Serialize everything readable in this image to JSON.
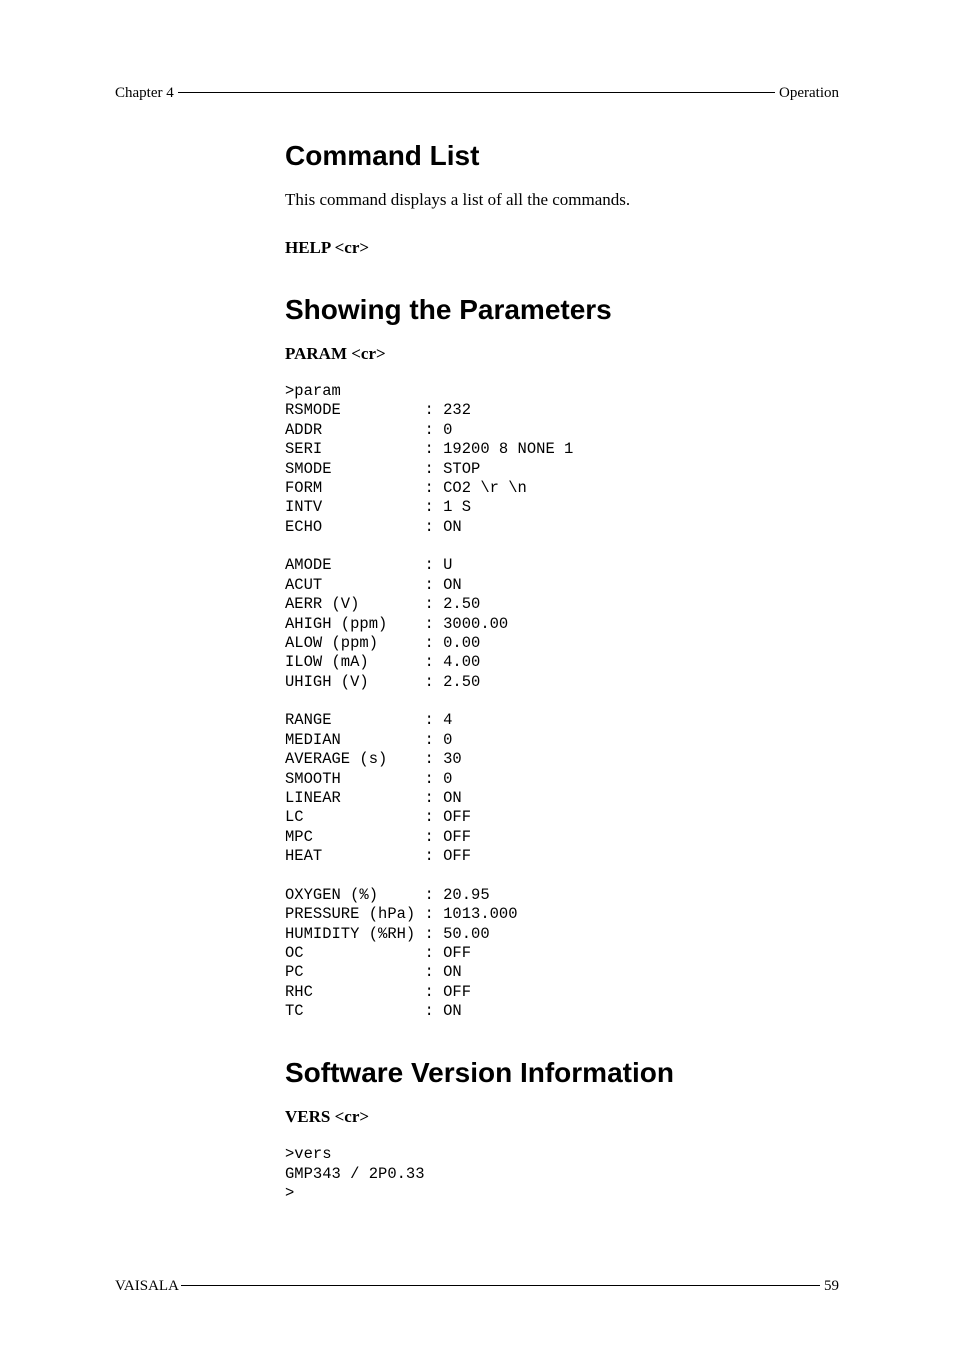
{
  "header": {
    "left": "Chapter 4",
    "right": "Operation"
  },
  "sections": {
    "command_list": {
      "title": "Command List",
      "desc": "This command displays a list of all the commands.",
      "cmd": "HELP <cr>"
    },
    "showing_params": {
      "title": "Showing the Parameters",
      "cmd": "PARAM <cr>",
      "output": ">param\nRSMODE         : 232\nADDR           : 0\nSERI           : 19200 8 NONE 1\nSMODE          : STOP\nFORM           : CO2 \\r \\n\nINTV           : 1 S\nECHO           : ON\n\nAMODE          : U\nACUT           : ON\nAERR (V)       : 2.50\nAHIGH (ppm)    : 3000.00\nALOW (ppm)     : 0.00\nILOW (mA)      : 4.00\nUHIGH (V)      : 2.50\n\nRANGE          : 4\nMEDIAN         : 0\nAVERAGE (s)    : 30\nSMOOTH         : 0\nLINEAR         : ON\nLC             : OFF\nMPC            : OFF\nHEAT           : OFF\n\nOXYGEN (%)     : 20.95\nPRESSURE (hPa) : 1013.000\nHUMIDITY (%RH) : 50.00\nOC             : OFF\nPC             : ON\nRHC            : OFF\nTC             : ON"
    },
    "software_version": {
      "title": "Software Version Information",
      "cmd": "VERS <cr>",
      "output": ">vers\nGMP343 / 2P0.33\n>"
    }
  },
  "footer": {
    "left": "VAISALA",
    "page": "59"
  }
}
